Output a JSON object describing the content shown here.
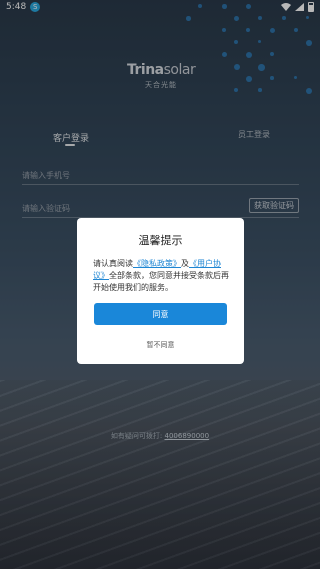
{
  "status_bar": {
    "time": "5:48",
    "badge": "S"
  },
  "logo": {
    "brand_main": "Trina",
    "brand_solar": "solar",
    "brand_cn": "天合光能"
  },
  "tabs": {
    "customer_login": "客户登录",
    "staff_login": "员工登录"
  },
  "form": {
    "phone_placeholder": "请输入手机号",
    "code_placeholder": "请输入验证码",
    "get_code_label": "获取验证码"
  },
  "modal": {
    "title": "温馨提示",
    "body_prefix": "请认真阅读",
    "privacy_link": "《隐私政策》",
    "and": "及",
    "user_agreement_link": "《用户协议》",
    "body_suffix": "全部条款，您同意并接受条款后再开始使用我们的服务。",
    "agree_label": "同意",
    "disagree_label": "暂不同意"
  },
  "footer": {
    "question_text": "如有疑问可拨打:",
    "phone": "4006890000"
  },
  "colors": {
    "accent": "#1a87d9",
    "link": "#1f86d3"
  }
}
